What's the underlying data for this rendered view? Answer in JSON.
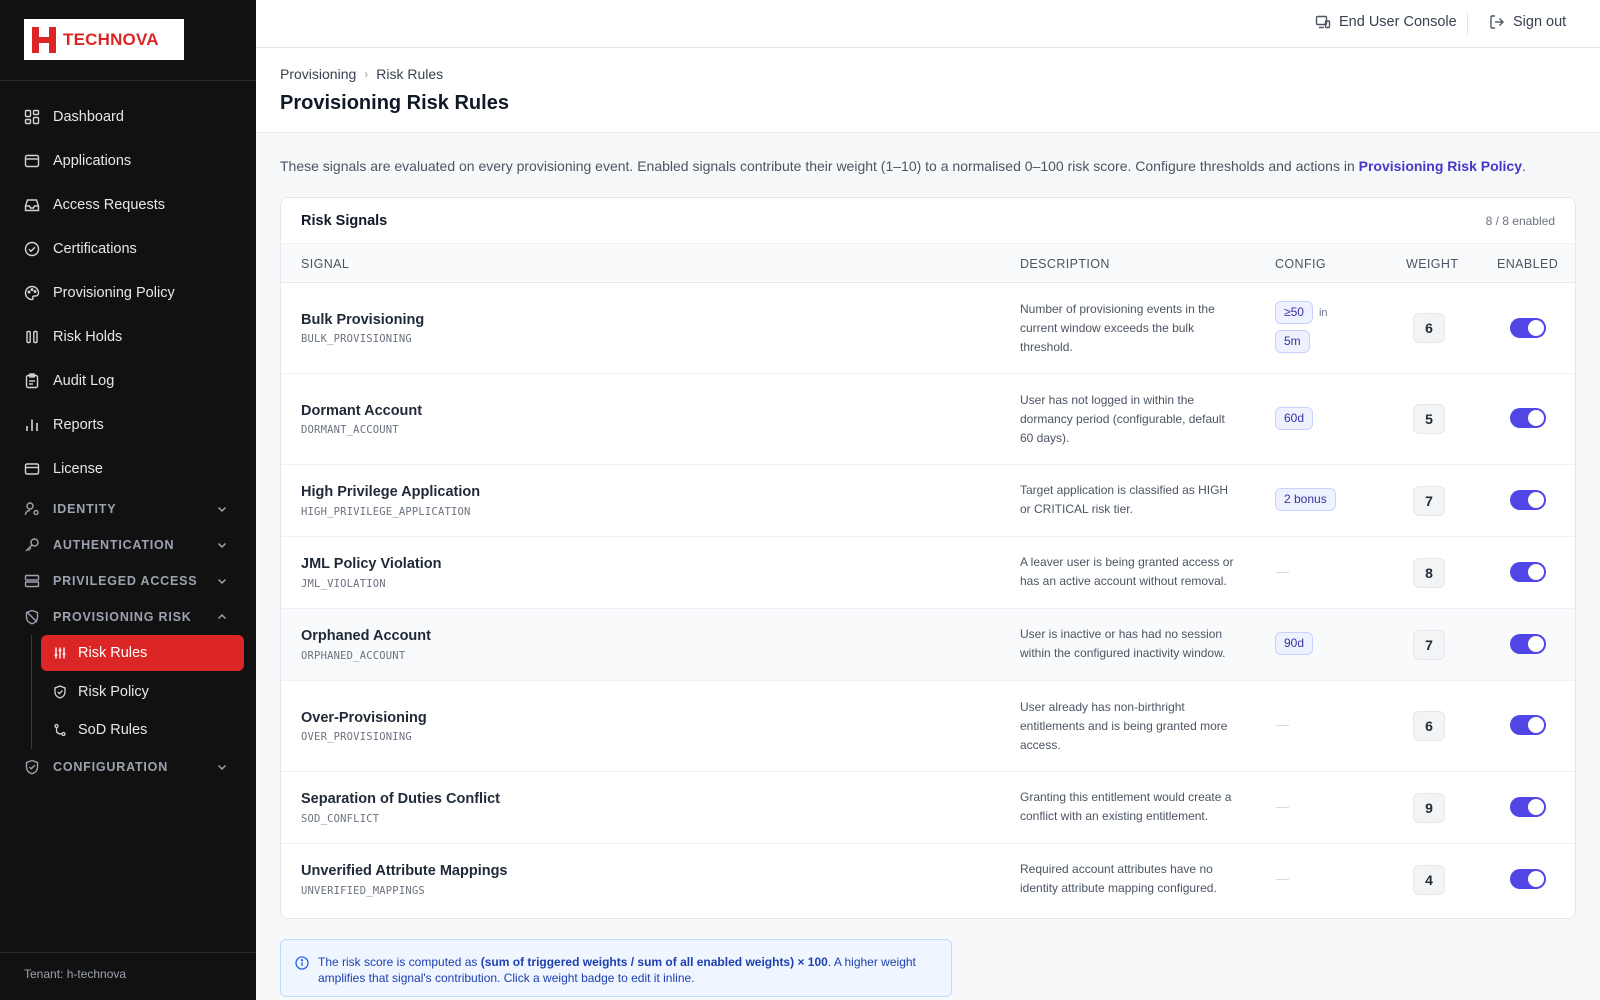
{
  "brand": {
    "name": "TECHNOVA"
  },
  "sidebar": {
    "items": [
      {
        "label": "Dashboard",
        "icon": "dashboard-icon"
      },
      {
        "label": "Applications",
        "icon": "window-icon"
      },
      {
        "label": "Access Requests",
        "icon": "inbox-icon"
      },
      {
        "label": "Certifications",
        "icon": "check-circle-icon"
      },
      {
        "label": "Provisioning Policy",
        "icon": "palette-icon"
      },
      {
        "label": "Risk Holds",
        "icon": "pause-icon"
      },
      {
        "label": "Audit Log",
        "icon": "clipboard-icon"
      },
      {
        "label": "Reports",
        "icon": "bar-chart-icon"
      },
      {
        "label": "License",
        "icon": "credit-card-icon"
      }
    ],
    "sections": [
      {
        "label": "IDENTITY",
        "icon": "user-cog-icon"
      },
      {
        "label": "AUTHENTICATION",
        "icon": "key-icon"
      },
      {
        "label": "PRIVILEGED ACCESS",
        "icon": "server-icon"
      },
      {
        "label": "PROVISIONING RISK",
        "icon": "shield-off-icon"
      },
      {
        "label": "CONFIGURATION",
        "icon": "shield-check-icon"
      }
    ],
    "sub_items": [
      {
        "label": "Risk Rules",
        "icon": "sliders-icon",
        "active": true
      },
      {
        "label": "Risk Policy",
        "icon": "shield-check-icon"
      },
      {
        "label": "SoD Rules",
        "icon": "git-branch-icon"
      }
    ],
    "tenant": "Tenant: h-technova"
  },
  "topbar": {
    "console_label": "End User Console",
    "signout_label": "Sign out"
  },
  "header": {
    "breadcrumb": [
      "Provisioning",
      "Risk Rules"
    ],
    "title": "Provisioning Risk Rules"
  },
  "intro": {
    "text": "These signals are evaluated on every provisioning event. Enabled signals contribute their weight (1–10) to a normalised 0–100 risk score. Configure thresholds and actions in ",
    "link": "Provisioning Risk Policy",
    "end": "."
  },
  "card": {
    "title": "Risk Signals",
    "count": "8 / 8 enabled",
    "columns": [
      "SIGNAL",
      "DESCRIPTION",
      "CONFIG",
      "WEIGHT",
      "ENABLED"
    ]
  },
  "signals": [
    {
      "name": "Bulk Provisioning",
      "code": "BULK_PROVISIONING",
      "description": "Number of provisioning events in the current window exceeds the bulk threshold.",
      "config": [
        "≥50",
        "5m"
      ],
      "config_joiner": "in",
      "weight": "6",
      "enabled": true
    },
    {
      "name": "Dormant Account",
      "code": "DORMANT_ACCOUNT",
      "description": "User has not logged in within the dormancy period (configurable, default 60 days).",
      "config": [
        "60d"
      ],
      "weight": "5",
      "enabled": true
    },
    {
      "name": "High Privilege Application",
      "code": "HIGH_PRIVILEGE_APPLICATION",
      "description": "Target application is classified as HIGH or CRITICAL risk tier.",
      "config": [
        "2 bonus"
      ],
      "weight": "7",
      "enabled": true
    },
    {
      "name": "JML Policy Violation",
      "code": "JML_VIOLATION",
      "description": "A leaver user is being granted access or has an active account without removal.",
      "config": [],
      "empty": "—",
      "weight": "8",
      "enabled": true
    },
    {
      "name": "Orphaned Account",
      "code": "ORPHANED_ACCOUNT",
      "description": "User is inactive or has had no session within the configured inactivity window.",
      "config": [
        "90d"
      ],
      "weight": "7",
      "enabled": true
    },
    {
      "name": "Over-Provisioning",
      "code": "OVER_PROVISIONING",
      "description": "User already has non-birthright entitlements and is being granted more access.",
      "config": [],
      "empty": "—",
      "weight": "6",
      "enabled": true
    },
    {
      "name": "Separation of Duties Conflict",
      "code": "SOD_CONFLICT",
      "description": "Granting this entitlement would create a conflict with an existing entitlement.",
      "config": [],
      "empty": "—",
      "weight": "9",
      "enabled": true
    },
    {
      "name": "Unverified Attribute Mappings",
      "code": "UNVERIFIED_MAPPINGS",
      "description": "Required account attributes have no identity attribute mapping configured.",
      "config": [],
      "empty": "—",
      "weight": "4",
      "enabled": true
    }
  ],
  "info": {
    "pre": "The risk score is computed as ",
    "formula": "(sum of triggered weights / sum of all enabled weights) × 100",
    "post": ". A higher weight amplifies that signal's contribution. Click a weight badge to edit it inline."
  },
  "colors": {
    "accent": "#4f46e5",
    "brand": "#dc2626",
    "sidebar": "#111111"
  }
}
